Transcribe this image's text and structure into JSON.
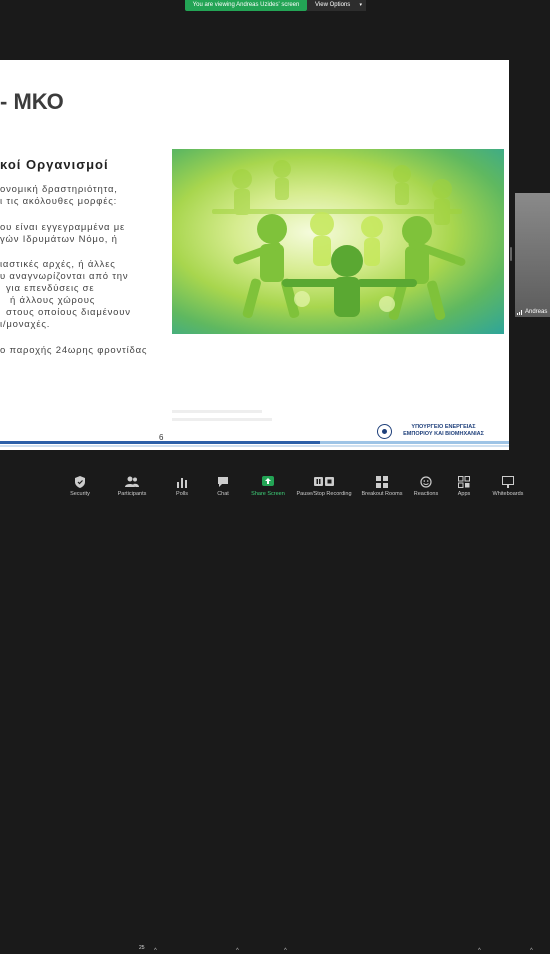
{
  "banner": {
    "viewing_text": "You are viewing Andreas Uzides' screen",
    "view_options_label": "View Options"
  },
  "slide": {
    "title": "- ΜΚΟ",
    "subtitle": "κοί Οργανισμοί",
    "paragraph1": [
      "ονομική δραστηριότητα,",
      "ι τις ακόλουθες μορφές:"
    ],
    "paragraph2": [
      "ου είναι εγγεγραμμένα με",
      "γών Ιδρυμάτων Νόμο, ή"
    ],
    "paragraph3": [
      "ιαστικές αρχές, ή άλλες",
      "υ αναγνωρίζονται από την",
      "για επενδύσεις σε",
      "ή άλλους χώρους",
      "στους οποίους διαμένουν",
      "ι/μοναχές."
    ],
    "paragraph4": [
      "ο παροχής 24ωρης φροντίδας"
    ],
    "page_number": "6",
    "logo_text_line1": "ΥΠΟΥΡΓΕΙΟ ΕΝΕΡΓΕΙΑΣ",
    "logo_text_line2": "ΕΜΠΟΡΙΟΥ ΚΑΙ ΒΙΟΜΗΧΑΝΙΑΣ"
  },
  "participant_thumb": {
    "name": "Andreas"
  },
  "toolbar": {
    "security": "Security",
    "participants": "Participants",
    "participants_count": "25",
    "polls": "Polls",
    "chat": "Chat",
    "share_screen": "Share Screen",
    "recording": "Pause/Stop Recording",
    "breakout": "Breakout Rooms",
    "reactions": "Reactions",
    "apps": "Apps",
    "whiteboards": "Whiteboards"
  },
  "colors": {
    "accent_green": "#23a455",
    "toolbar_bg": "#1a1a1a",
    "logo_blue": "#1e3f7a"
  }
}
